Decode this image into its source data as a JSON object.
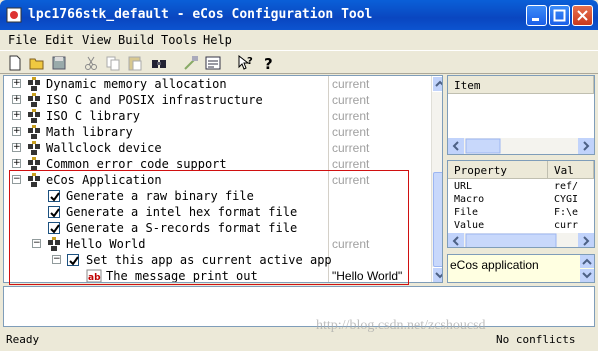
{
  "window": {
    "title": "lpc1766stk_default - eCos Configuration Tool"
  },
  "menu": [
    "File",
    "Edit",
    "View",
    "Build",
    "Tools",
    "Help"
  ],
  "toolbar": {
    "icons": [
      "new-file-icon",
      "open-folder-icon",
      "save-icon",
      "cut-icon",
      "copy-icon",
      "paste-icon",
      "find-icon",
      "build-icon",
      "packages-icon",
      "whats-this-icon",
      "help-icon"
    ]
  },
  "tree": {
    "rows": [
      {
        "label": "Dynamic memory allocation",
        "value": "current"
      },
      {
        "label": "ISO C and POSIX infrastructure",
        "value": "current"
      },
      {
        "label": "ISO C library",
        "value": "current"
      },
      {
        "label": "Math library",
        "value": "current"
      },
      {
        "label": "Wallclock device",
        "value": "current"
      },
      {
        "label": "Common error code support",
        "value": "current"
      },
      {
        "label": "eCos Application",
        "value": "current"
      },
      {
        "label": "Generate a raw binary file",
        "value": ""
      },
      {
        "label": "Generate a intel hex format file",
        "value": ""
      },
      {
        "label": "Generate a S-records format file",
        "value": ""
      },
      {
        "label": "Hello World",
        "value": "current"
      },
      {
        "label": "Set this app as current active app",
        "value": ""
      },
      {
        "label": "The message print out",
        "value": "\"Hello World\""
      }
    ]
  },
  "item_panel": {
    "header": "Item"
  },
  "properties": {
    "headers": [
      "Property",
      "Val"
    ],
    "rows": [
      {
        "name": "URL",
        "value": "ref/"
      },
      {
        "name": "Macro",
        "value": "CYGI"
      },
      {
        "name": "File",
        "value": "F:\\e"
      },
      {
        "name": "Value",
        "value": "curr"
      }
    ]
  },
  "description": "eCos application",
  "status": {
    "left": "Ready",
    "right": "No conflicts"
  },
  "watermark": "http://blog.csdn.net/zcshoucsd",
  "colors": {
    "titlebar": "#0a4fc8",
    "highlight_box": "#d01010",
    "inactive_value": "#a0a0a0"
  }
}
